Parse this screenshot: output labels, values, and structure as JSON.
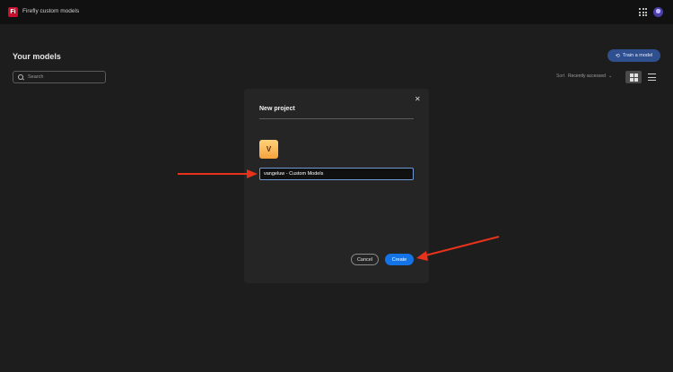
{
  "app": {
    "title": "Firefly custom models",
    "logo_text": "Fi"
  },
  "page": {
    "title": "Your models"
  },
  "search": {
    "placeholder": "Search"
  },
  "toolbar": {
    "train_label": "Train a model",
    "sort_label": "Sort",
    "sort_value": "Recently accessed"
  },
  "dialog": {
    "title": "New project",
    "avatar_letter": "V",
    "name_value": "vangeluw - Custom Models",
    "cancel_label": "Cancel",
    "create_label": "Create"
  },
  "colors": {
    "accent": "#1473e6",
    "annotation": "#e8321c",
    "background": "#1d1d1d"
  }
}
